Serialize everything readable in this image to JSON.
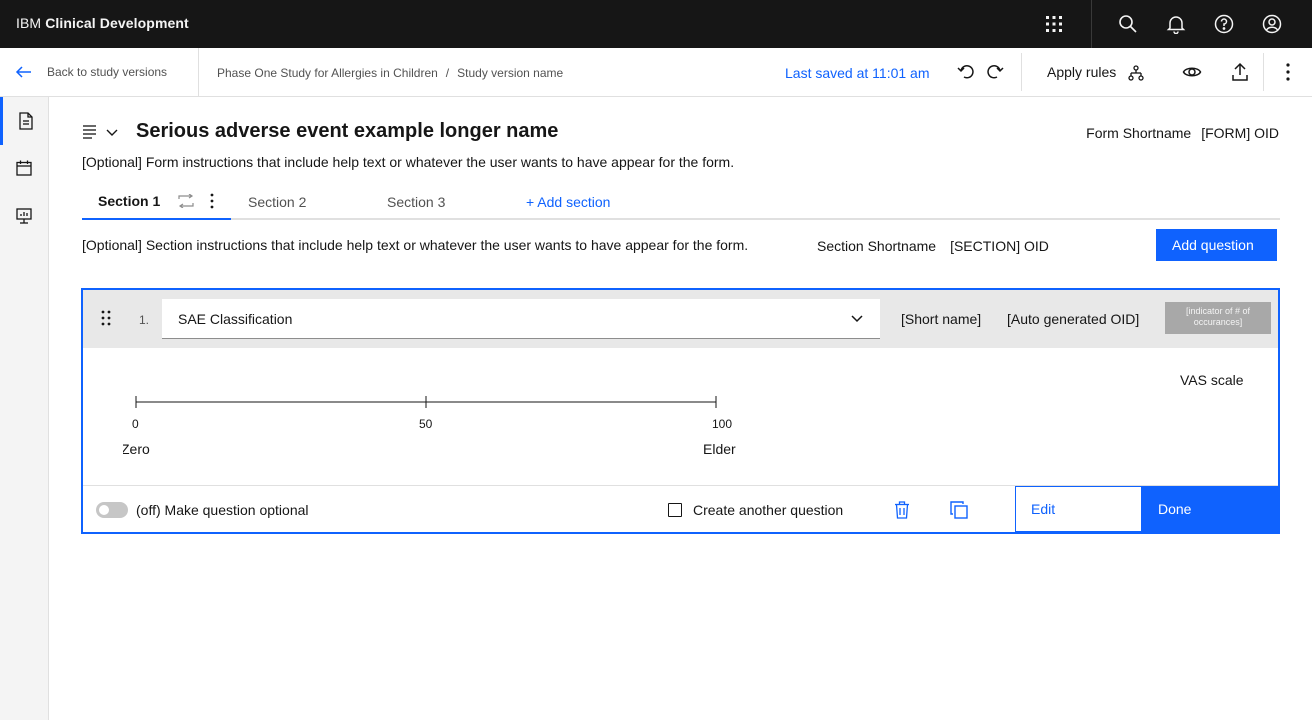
{
  "header": {
    "brand_prefix": "IBM",
    "brand_name": "Clinical Development",
    "icons": [
      "app-switcher-icon",
      "search-icon",
      "notification-icon",
      "help-icon",
      "user-avatar-icon"
    ]
  },
  "subheader": {
    "back_label": "Back to study versions",
    "breadcrumb": [
      "Phase One Study for Allergies in Children",
      "Study version name"
    ],
    "breadcrumb_separator": "/",
    "last_saved": "Last saved at 11:01 am",
    "apply_rules_label": "Apply rules"
  },
  "rail": {
    "items": [
      "document-icon",
      "calendar-icon",
      "presentation-icon"
    ],
    "active_index": 0
  },
  "form": {
    "title": "Serious adverse event example longer name",
    "shortname_label": "Form Shortname",
    "oid_label": "[FORM] OID",
    "instructions": "[Optional] Form instructions that include help text or whatever the user wants to have appear for the form."
  },
  "tabs": {
    "items": [
      "Section 1",
      "Section 2",
      "Section 3"
    ],
    "active": "Section 1",
    "add_label": "+ Add section"
  },
  "section": {
    "instructions": "[Optional] Section instructions that include help text or whatever the user wants to have appear for the form.",
    "shortname_label": "Section Shortname",
    "oid_label": "[SECTION] OID",
    "add_question_label": "Add question"
  },
  "question": {
    "number": "1.",
    "selected": "SAE Classification",
    "short_name": "[Short name]",
    "auto_oid": "[Auto generated OID]",
    "indicator": "[indicator of # of occurances]",
    "type_label": "VAS scale",
    "scale": {
      "min": 0,
      "mid": 50,
      "max": 100,
      "tick_labels": [
        "0",
        "50",
        "100"
      ],
      "min_anchor": "Zero",
      "max_anchor": "Elder"
    },
    "optional_label": "(off) Make question optional",
    "optional_on": false,
    "create_another_label": "Create another question",
    "create_another_checked": false,
    "edit_label": "Edit",
    "done_label": "Done"
  },
  "colors": {
    "accent": "#0f62fe",
    "header_bg": "#161616",
    "card_head_bg": "#e8e8e8"
  }
}
